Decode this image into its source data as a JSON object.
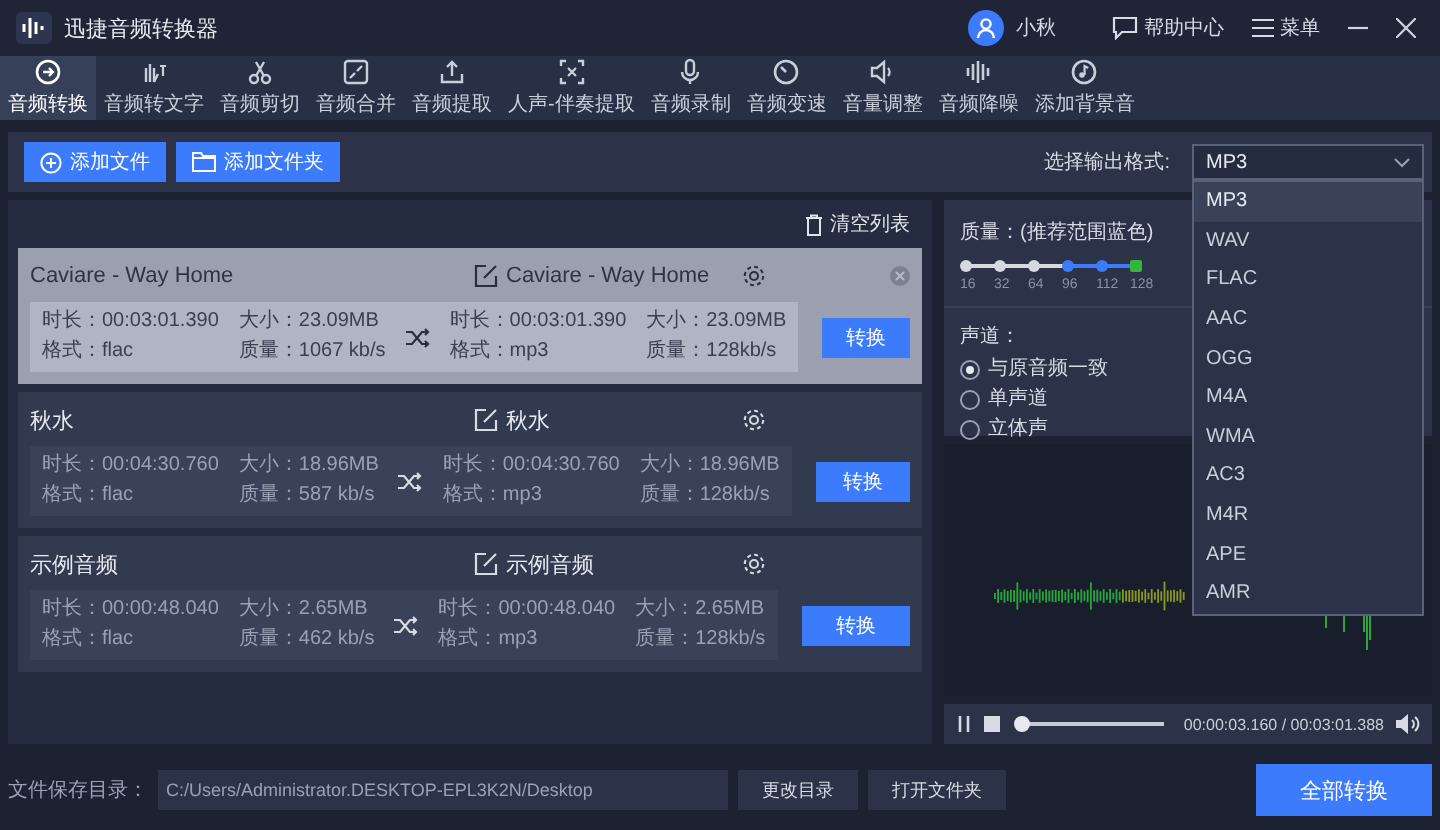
{
  "app": {
    "title": "迅捷音频转换器",
    "user": "小秋",
    "help": "帮助中心",
    "menu": "菜单"
  },
  "tabs": [
    {
      "label": "音频转换",
      "selected": true
    },
    {
      "label": "音频转文字",
      "selected": false
    },
    {
      "label": "音频剪切",
      "selected": false
    },
    {
      "label": "音频合并",
      "selected": false
    },
    {
      "label": "音频提取",
      "selected": false
    },
    {
      "label": "人声-伴奏提取",
      "selected": false
    },
    {
      "label": "音频录制",
      "selected": false
    },
    {
      "label": "音频变速",
      "selected": false
    },
    {
      "label": "音量调整",
      "selected": false
    },
    {
      "label": "音频降噪",
      "selected": false
    },
    {
      "label": "添加背景音",
      "selected": false
    }
  ],
  "actions": {
    "add_file": "添加文件",
    "add_folder": "添加文件夹",
    "format_label": "选择输出格式:",
    "format_value": "MP3"
  },
  "format_options": [
    {
      "label": "MP3",
      "selected": true
    },
    {
      "label": "WAV",
      "selected": false
    },
    {
      "label": "FLAC",
      "selected": false
    },
    {
      "label": "AAC",
      "selected": false
    },
    {
      "label": "OGG",
      "selected": false
    },
    {
      "label": "M4A",
      "selected": false
    },
    {
      "label": "WMA",
      "selected": false
    },
    {
      "label": "AC3",
      "selected": false
    },
    {
      "label": "M4R",
      "selected": false
    },
    {
      "label": "APE",
      "selected": false
    },
    {
      "label": "AMR",
      "selected": false
    }
  ],
  "list": {
    "clear": "清空列表",
    "files": [
      {
        "selected": true,
        "source": {
          "name": "Caviare - Way Home",
          "duration": "时长：00:03:01.390",
          "size": "大小：23.09MB",
          "format": "格式：flac",
          "quality": "质量：1067 kb/s"
        },
        "target": {
          "name": "Caviare - Way Home",
          "duration": "时长：00:03:01.390",
          "size": "大小：23.09MB",
          "format": "格式：mp3",
          "quality": "质量：128kb/s"
        },
        "button": "转换"
      },
      {
        "selected": false,
        "source": {
          "name": "秋水",
          "duration": "时长：00:04:30.760",
          "size": "大小：18.96MB",
          "format": "格式：flac",
          "quality": "质量：587 kb/s"
        },
        "target": {
          "name": "秋水",
          "duration": "时长：00:04:30.760",
          "size": "大小：18.96MB",
          "format": "格式：mp3",
          "quality": "质量：128kb/s"
        },
        "button": "转换"
      },
      {
        "selected": false,
        "source": {
          "name": "示例音频",
          "duration": "时长：00:00:48.040",
          "size": "大小：2.65MB",
          "format": "格式：flac",
          "quality": "质量：462 kb/s"
        },
        "target": {
          "name": "示例音频",
          "duration": "时长：00:00:48.040",
          "size": "大小：2.65MB",
          "format": "格式：mp3",
          "quality": "质量：128kb/s"
        },
        "button": "转换"
      }
    ]
  },
  "settings": {
    "quality_label": "质量：(推荐范围蓝色)",
    "quality_points": [
      {
        "label": "16",
        "recommended": false,
        "selected": false
      },
      {
        "label": "32",
        "recommended": false,
        "selected": false
      },
      {
        "label": "64",
        "recommended": false,
        "selected": false
      },
      {
        "label": "96",
        "recommended": true,
        "selected": false
      },
      {
        "label": "112",
        "recommended": true,
        "selected": false
      },
      {
        "label": "128",
        "recommended": true,
        "selected": true
      }
    ],
    "channel_label": "声道：",
    "channels": [
      {
        "label": "与原音频一致",
        "selected": true
      },
      {
        "label": "单声道",
        "selected": false
      },
      {
        "label": "立体声",
        "selected": false
      }
    ]
  },
  "player": {
    "time": "00:00:03.160 / 00:03:01.388",
    "level": 0.02
  },
  "footer": {
    "path_label": "文件保存目录：",
    "path": "C:/Users/Administrator.DESKTOP-EPL3K2N/Desktop",
    "change_dir": "更改目录",
    "open_folder": "打开文件夹",
    "convert_all": "全部转换"
  }
}
